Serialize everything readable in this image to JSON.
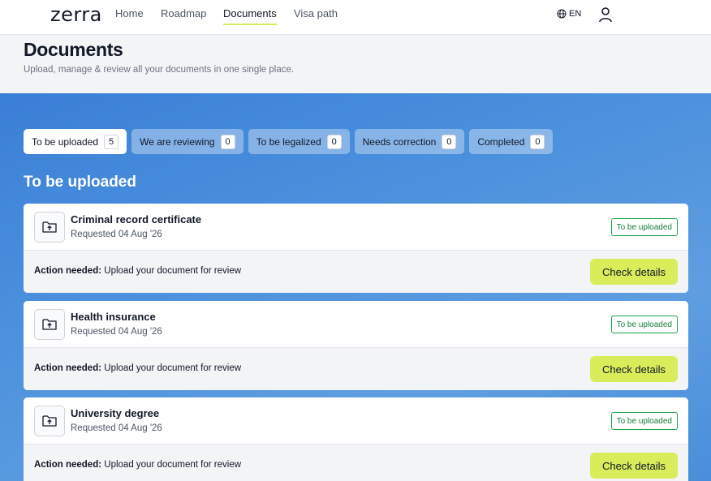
{
  "nav": {
    "logo": "zerra",
    "links": [
      {
        "label": "Home"
      },
      {
        "label": "Roadmap"
      },
      {
        "label": "Documents"
      },
      {
        "label": "Visa path"
      }
    ],
    "language": "EN"
  },
  "header": {
    "title": "Documents",
    "subtitle": "Upload, manage & review all your documents in one single place."
  },
  "tabs": [
    {
      "label": "To be uploaded",
      "count": "5"
    },
    {
      "label": "We are reviewing",
      "count": "0"
    },
    {
      "label": "To be legalized",
      "count": "0"
    },
    {
      "label": "Needs correction",
      "count": "0"
    },
    {
      "label": "Completed",
      "count": "0"
    }
  ],
  "section_title": "To be uploaded",
  "documents": [
    {
      "title": "Criminal record certificate",
      "requested": "Requested 04 Aug '26",
      "status": "To be uploaded",
      "action_label": "Action needed:",
      "action_text": "Upload your document for review",
      "button": "Check details"
    },
    {
      "title": "Health insurance",
      "requested": "Requested 04 Aug '26",
      "status": "To be uploaded",
      "action_label": "Action needed:",
      "action_text": "Upload your document for review",
      "button": "Check details"
    },
    {
      "title": "University degree",
      "requested": "Requested 04 Aug '26",
      "status": "To be uploaded",
      "action_label": "Action needed:",
      "action_text": "Upload your document for review",
      "button": "Check details"
    }
  ],
  "colors": {
    "accent": "#d9ec5a",
    "background_blue": "#4b90dd",
    "badge_green": "#16a34a"
  },
  "icons": {
    "language": "globe-icon",
    "user": "user-icon",
    "document": "folder-upload-icon"
  }
}
